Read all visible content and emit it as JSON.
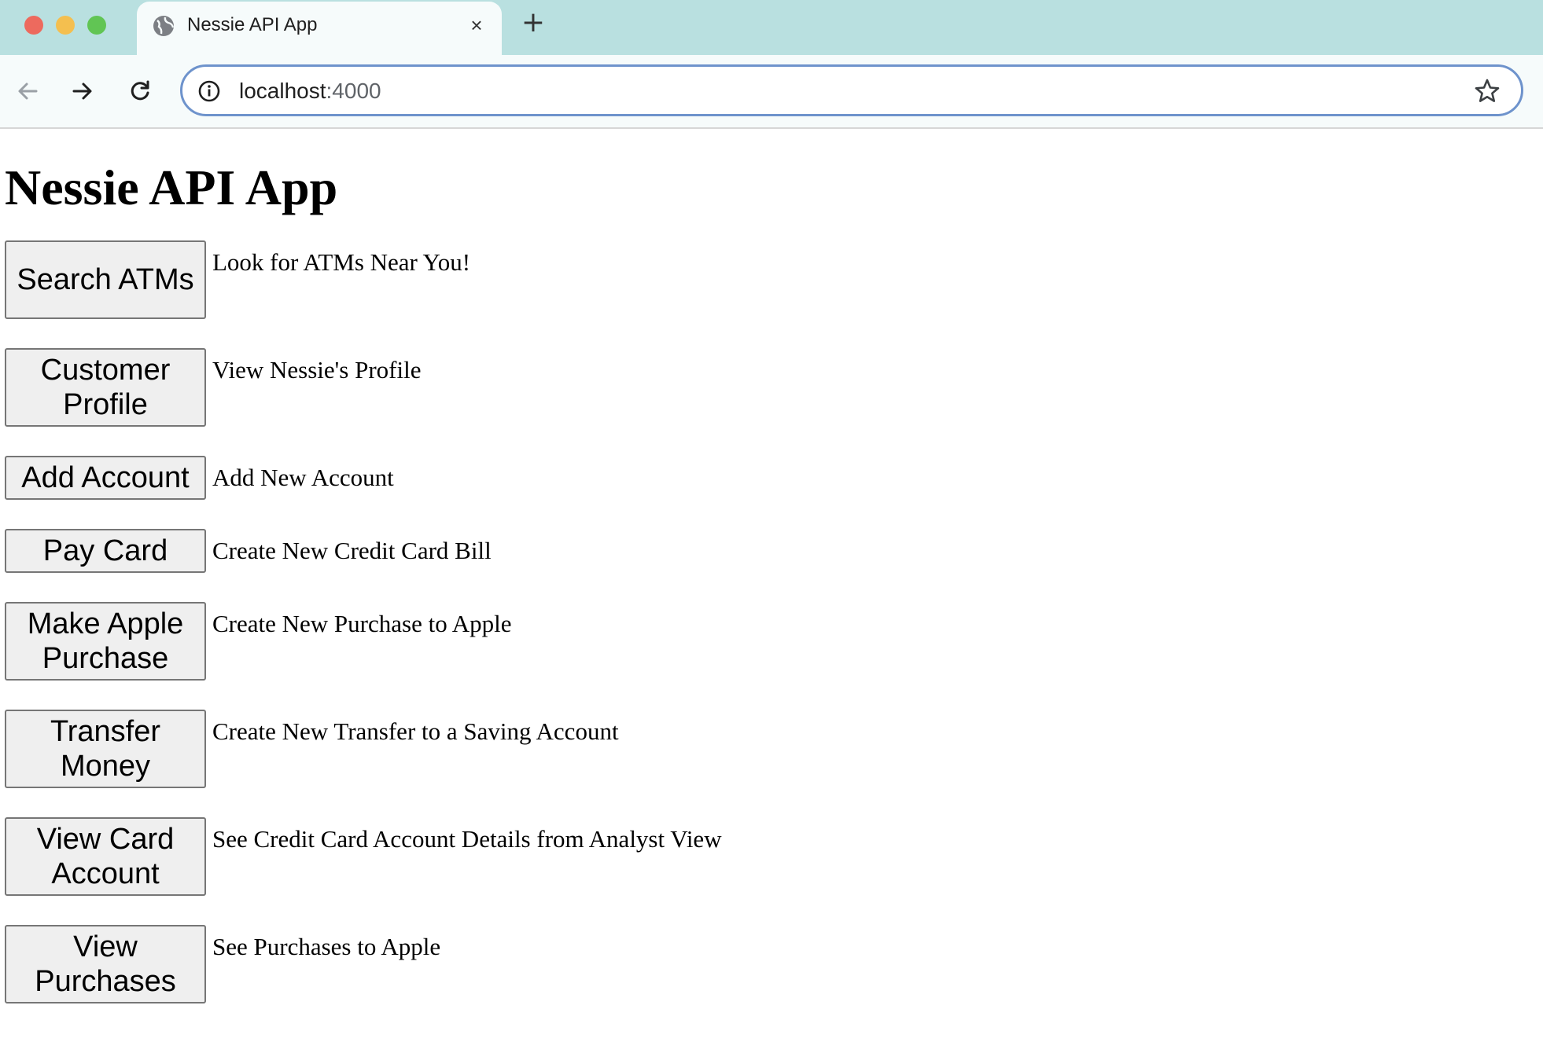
{
  "browser": {
    "tab_title": "Nessie API App",
    "tab_close": "×",
    "new_tab": "+",
    "url_host": "localhost",
    "url_port": ":4000"
  },
  "page": {
    "heading": "Nessie API App",
    "actions": [
      {
        "button": "Search ATMs",
        "description": "Look for ATMs Near You!"
      },
      {
        "button": "Customer Profile",
        "description": "View Nessie's Profile"
      },
      {
        "button": "Add Account",
        "description": "Add New Account"
      },
      {
        "button": "Pay Card",
        "description": "Create New Credit Card Bill"
      },
      {
        "button": "Make Apple Purchase",
        "description": "Create New Purchase to Apple"
      },
      {
        "button": "Transfer Money",
        "description": "Create New Transfer to a Saving Account"
      },
      {
        "button": "View Card Account",
        "description": "See Credit Card Account Details from Analyst View"
      },
      {
        "button": "View Purchases",
        "description": "See Purchases to Apple"
      }
    ]
  },
  "icons": {
    "window_controls": [
      "close",
      "minimize",
      "zoom"
    ],
    "toolbar": [
      "back-arrow-icon",
      "forward-arrow-icon",
      "reload-icon",
      "info-icon",
      "star-icon"
    ]
  },
  "colors": {
    "tabstrip": "#b9e0e0",
    "toolbar": "#f6fbfb",
    "omnibox_border": "#6e93cc",
    "button_bg": "#efefef"
  }
}
